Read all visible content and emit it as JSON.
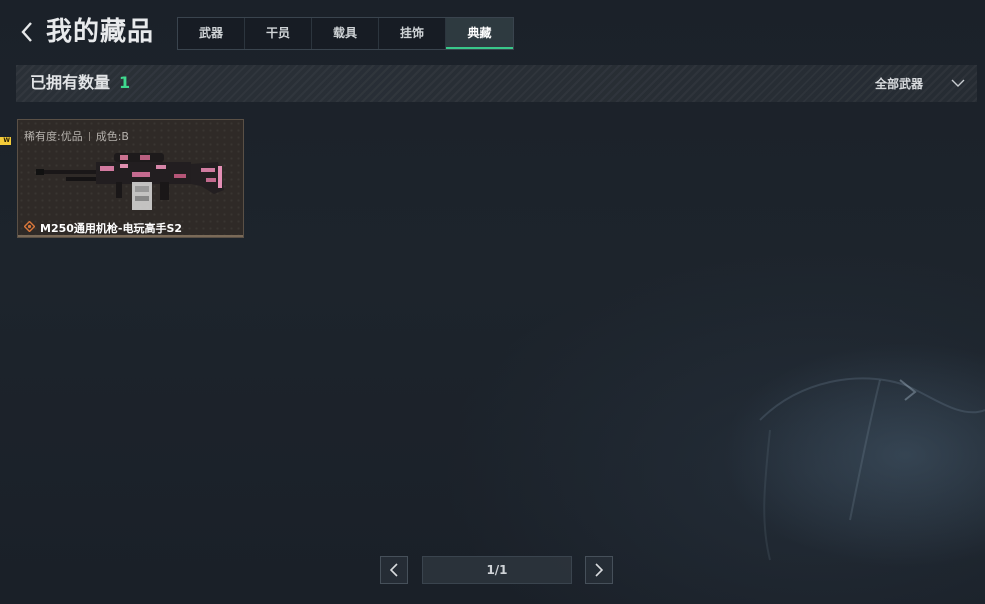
{
  "header": {
    "title": "我的藏品",
    "tabs": [
      {
        "label": "武器",
        "active": false
      },
      {
        "label": "干员",
        "active": false
      },
      {
        "label": "载具",
        "active": false
      },
      {
        "label": "挂饰",
        "active": false
      },
      {
        "label": "典藏",
        "active": true
      }
    ]
  },
  "summary": {
    "owned_label": "已拥有数量",
    "owned_count": "1",
    "filter_label": "全部武器"
  },
  "items": [
    {
      "new_badge": "W",
      "rarity": "稀有度:优品",
      "wear": "成色:B",
      "name": "M250通用机枪-电玩高手S2"
    }
  ],
  "pagination": {
    "page_text": "1/1"
  },
  "colors": {
    "accent_green": "#3fd98e",
    "new_badge_yellow": "#f3cb3a",
    "rarity_orange": "#d9773a"
  },
  "icons": {
    "back": "chevron-left-icon",
    "filter": "chevron-down-icon",
    "rarity": "diamond-rarity-icon",
    "prev": "chevron-left-icon",
    "next": "chevron-right-icon"
  }
}
